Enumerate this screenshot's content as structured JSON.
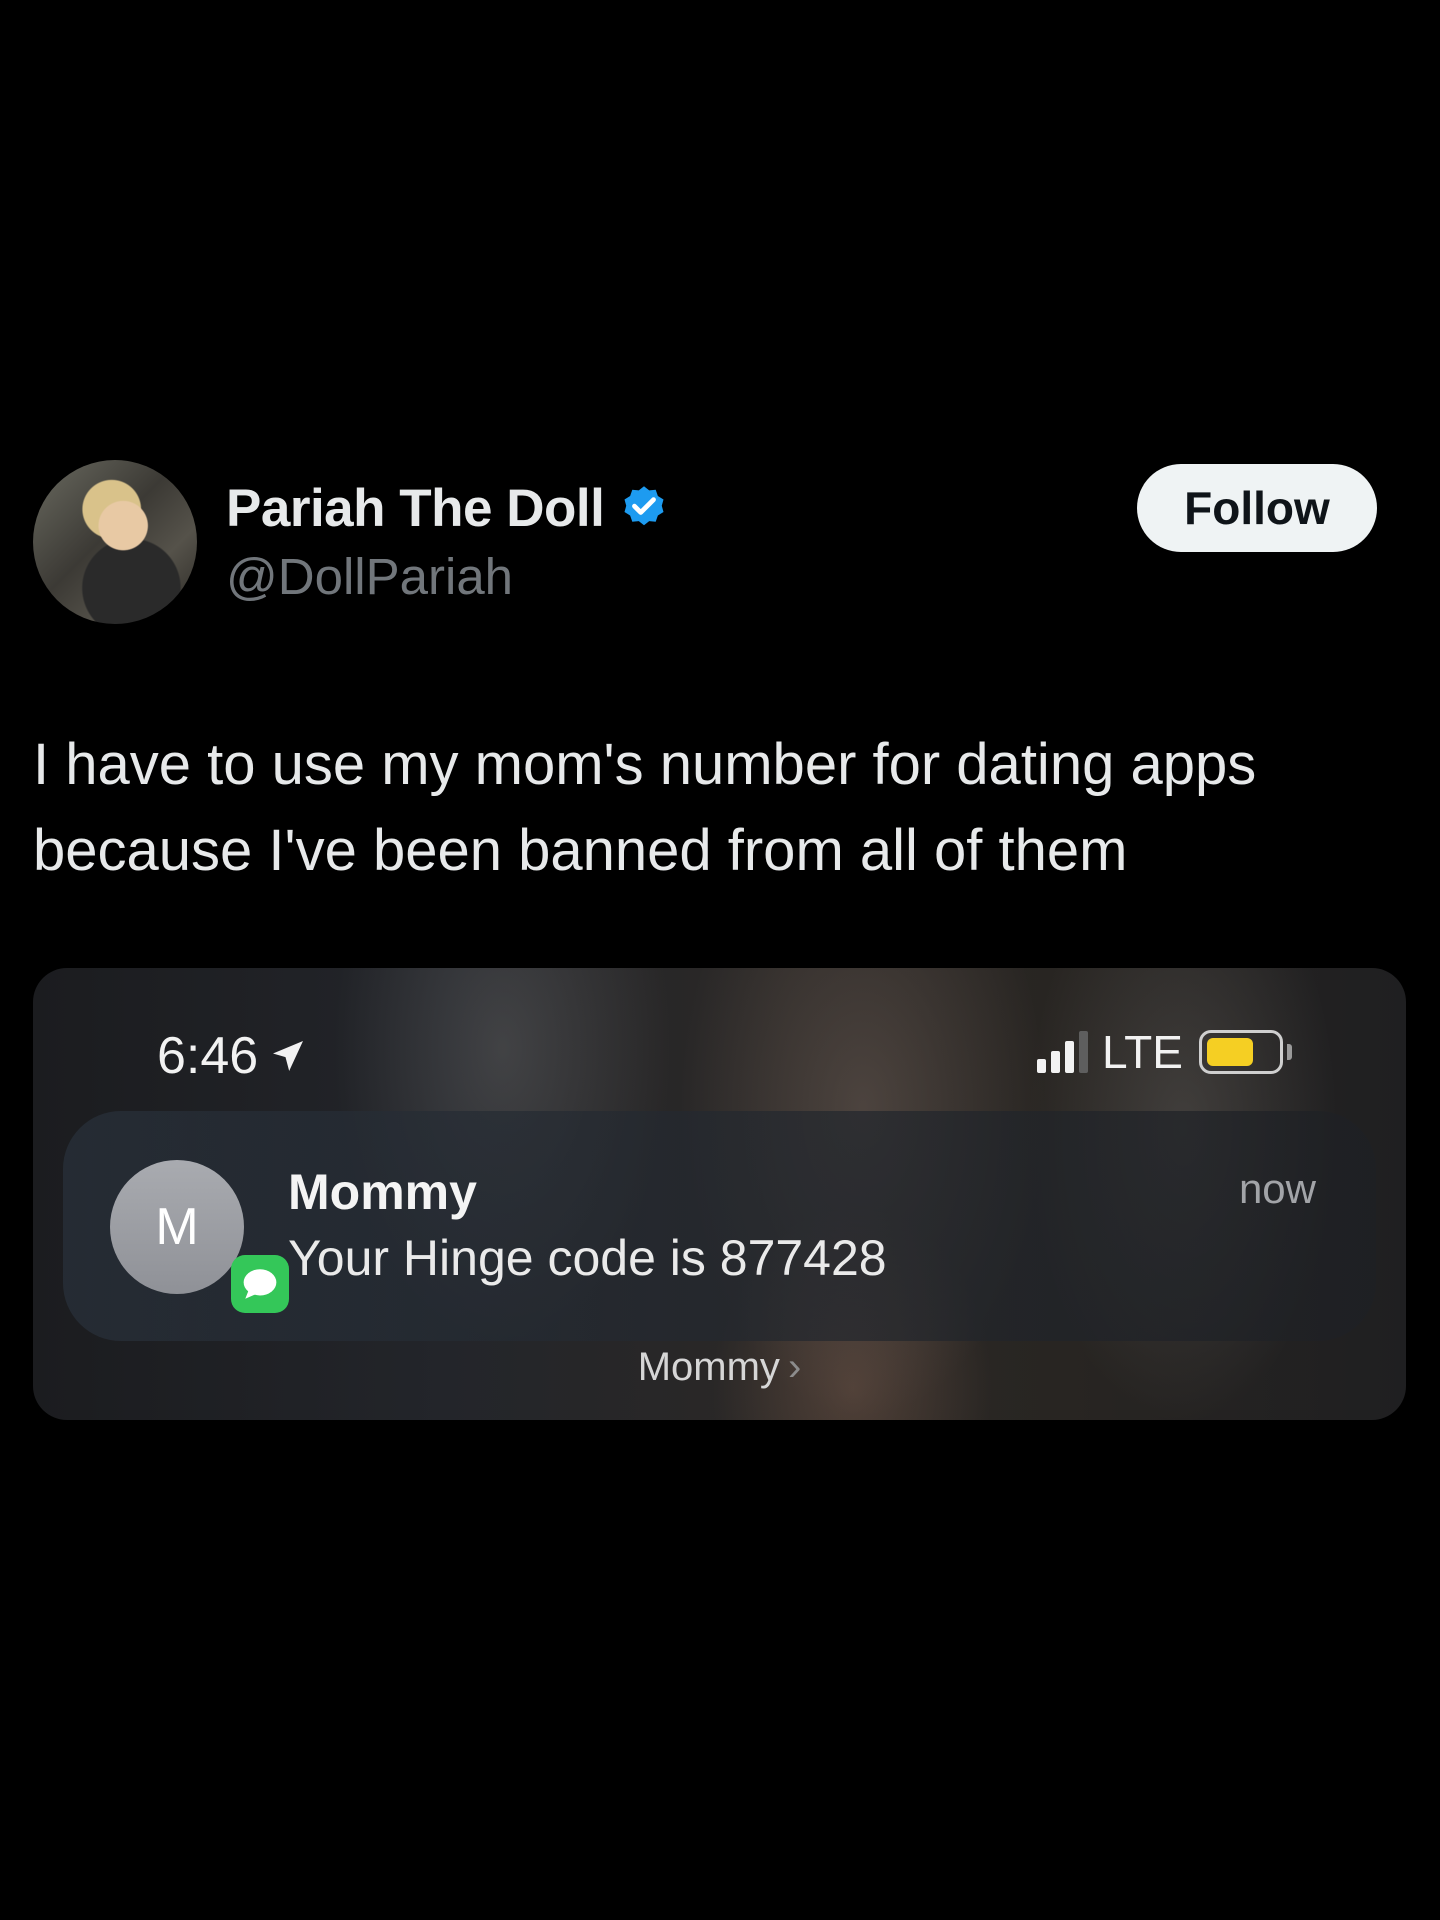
{
  "author": {
    "display_name": "Pariah The Doll",
    "handle": "@DollPariah",
    "verified_color": "#1d9bf0",
    "follow_label": "Follow"
  },
  "tweet": {
    "text": "I have to use my mom's number for dating apps because I've been banned from all of them"
  },
  "media": {
    "status_bar": {
      "time": "6:46",
      "network": "LTE",
      "battery_color": "#f5cf23",
      "signal_bars_active": 3,
      "signal_bars_total": 4
    },
    "notification": {
      "avatar_letter": "M",
      "sender": "Mommy",
      "message": "Your Hinge code is 877428",
      "time": "now",
      "app_icon": "messages-icon",
      "badge_color": "#34c759"
    },
    "footer_label": "Mommy",
    "footer_chevron": "›"
  }
}
